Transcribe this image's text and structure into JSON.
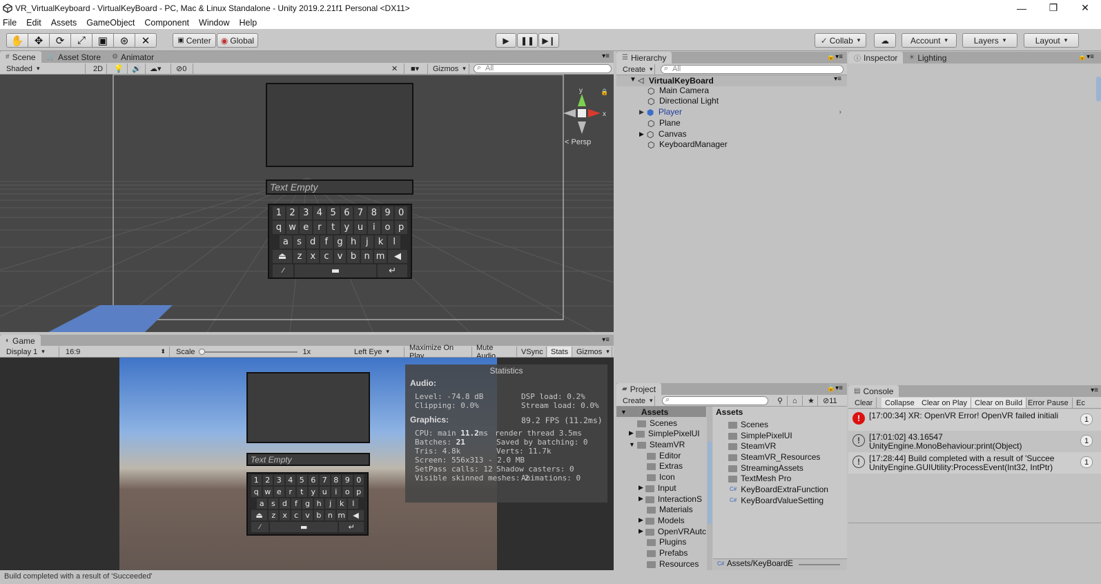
{
  "window": {
    "title": "VR_VirtualKeyboard - VirtualKeyBoard - PC, Mac & Linux Standalone - Unity 2019.2.21f1 Personal <DX11>"
  },
  "menu": [
    "File",
    "Edit",
    "Assets",
    "GameObject",
    "Component",
    "Window",
    "Help"
  ],
  "toolbar": {
    "tools": [
      "hand-icon",
      "move-icon",
      "rotate-icon",
      "scale-icon",
      "rect-icon",
      "transform-icon",
      "custom-tool-icon"
    ],
    "pivot": "Center",
    "space": "Global",
    "collab": "Collab",
    "account": "Account",
    "layers": "Layers",
    "layout": "Layout"
  },
  "scene_panel": {
    "tabs": [
      "Scene",
      "Asset Store",
      "Animator"
    ],
    "shading": "Shaded",
    "mode_2d": "2D",
    "fx_count": "0",
    "gizmos": "Gizmos",
    "search_placeholder": "All",
    "persp": "Persp"
  },
  "keyboard": {
    "placeholder": "Text Empty",
    "row1": [
      "1",
      "2",
      "3",
      "4",
      "5",
      "6",
      "7",
      "8",
      "9",
      "0"
    ],
    "row2": [
      "q",
      "w",
      "e",
      "r",
      "t",
      "y",
      "u",
      "i",
      "o",
      "p"
    ],
    "row3": [
      "a",
      "s",
      "d",
      "f",
      "g",
      "h",
      "j",
      "k",
      "l"
    ],
    "row4": [
      "z",
      "x",
      "c",
      "v",
      "b",
      "n",
      "m"
    ]
  },
  "game_panel": {
    "tab": "Game",
    "display": "Display 1",
    "aspect": "16:9",
    "scale_label": "Scale",
    "scale_value": "1x",
    "eye": "Left Eye",
    "maximize": "Maximize On Play",
    "mute": "Mute Audio",
    "vsync": "VSync",
    "stats": "Stats",
    "gizmos": "Gizmos"
  },
  "statistics": {
    "title": "Statistics",
    "audio_header": "Audio:",
    "level": "Level: -74.8 dB",
    "clipping": "Clipping: 0.0%",
    "dsp": "DSP load: 0.2%",
    "stream": "Stream load: 0.0%",
    "graphics_header": "Graphics:",
    "fps": "89.2 FPS (11.2ms)",
    "cpu_label": "CPU: main ",
    "cpu_main": "11.2",
    "cpu_unit": "ms",
    "render_thread": "render thread 3.5ms",
    "batches_label": "Batches: ",
    "batches": "21",
    "saved_batching": "Saved by batching: 0",
    "tris": "Tris: 4.8k",
    "verts": "Verts: 11.7k",
    "screen": "Screen: 556x313 - 2.0 MB",
    "setpass": "SetPass calls: 12",
    "shadow": "Shadow casters: 0",
    "skinned": "Visible skinned meshes: 2",
    "animations": "Animations: 0"
  },
  "hierarchy": {
    "tab": "Hierarchy",
    "create": "Create",
    "search_placeholder": "All",
    "root": "VirtualKeyBoard",
    "items": [
      "Main Camera",
      "Directional Light",
      "Player",
      "Plane",
      "Canvas",
      "KeyboardManager"
    ]
  },
  "inspector": {
    "tabs": [
      "Inspector",
      "Lighting"
    ]
  },
  "project": {
    "tab": "Project",
    "create": "Create",
    "hidden_count": "11",
    "tree": [
      "Assets",
      "Scenes",
      "SimplePixelUI",
      "SteamVR",
      "Editor",
      "Extras",
      "Icon",
      "Input",
      "InteractionS",
      "Materials",
      "Models",
      "OpenVRAutc",
      "Plugins",
      "Prefabs",
      "Resources"
    ],
    "assets_header": "Assets",
    "assets": [
      "Scenes",
      "SimplePixelUI",
      "SteamVR",
      "SteamVR_Resources",
      "StreamingAssets",
      "TextMesh Pro",
      "KeyBoardExtraFunction",
      "KeyBoardValueSetting"
    ],
    "path": "Assets/KeyBoardE"
  },
  "console": {
    "tab": "Console",
    "buttons": [
      "Clear",
      "Collapse",
      "Clear on Play",
      "Clear on Build",
      "Error Pause",
      "Ec"
    ],
    "entries": [
      {
        "type": "error",
        "line1": "[17:00:34] XR: OpenVR Error! OpenVR failed initiali",
        "line2": "",
        "count": "1"
      },
      {
        "type": "log",
        "line1": "[17:01:02] 43.16547",
        "line2": "UnityEngine.MonoBehaviour:print(Object)",
        "count": "1"
      },
      {
        "type": "log",
        "line1": "[17:28:44] Build completed with a result of 'Succee",
        "line2": "UnityEngine.GUIUtility:ProcessEvent(Int32, IntPtr)",
        "count": "1"
      }
    ]
  },
  "statusbar": {
    "text": "Build completed with a result of 'Succeeded'"
  }
}
